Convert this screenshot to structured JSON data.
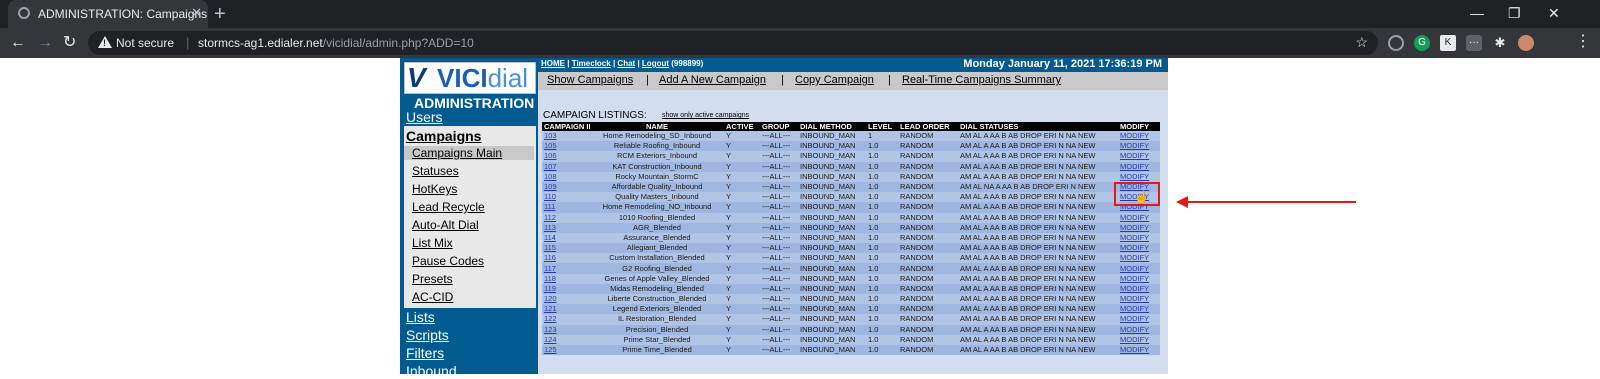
{
  "browser": {
    "tab_title": "ADMINISTRATION: Campaigns",
    "tab_close": "✕",
    "new_tab": "+",
    "minimize": "—",
    "restore": "❐",
    "close": "✕",
    "back": "←",
    "forward": "→",
    "reload": "↻",
    "not_secure": "Not secure",
    "url_host": "stormcs-ag1.edialer.net",
    "url_path": "/vicidial/admin.php?ADD=10",
    "star": "☆",
    "menu": "⋮"
  },
  "sidebar": {
    "logo_v": "V",
    "logo_vici": "VICI",
    "logo_dial": "dial",
    "admin_title": "ADMINISTRATION",
    "users": "Users",
    "campaigns": "Campaigns",
    "sub_items": [
      "Campaigns Main",
      "Statuses",
      "HotKeys",
      "Lead Recycle",
      "Auto-Alt Dial",
      "List Mix",
      "Pause Codes",
      "Presets",
      "AC-CID"
    ],
    "lists": "Lists",
    "scripts": "Scripts",
    "filters": "Filters",
    "inbound": "Inbound"
  },
  "topbar": {
    "home": "HOME",
    "timeclock": "Timeclock",
    "chat": "Chat",
    "logout": "Logout",
    "user": "(998899)",
    "sep": "|",
    "date": "Monday January 11, 2021 17:36:19 PM"
  },
  "subnav": {
    "items": [
      "Show Campaigns",
      "Add A New Campaign",
      "Copy Campaign",
      "Real-Time Campaigns Summary"
    ],
    "sep": "|"
  },
  "listing": {
    "title": "CAMPAIGN LISTINGS:",
    "active_link": "show only active campaigns"
  },
  "table": {
    "headers": [
      "CAMPAIGN ID",
      "NAME",
      "ACTIVE",
      "GROUP",
      "DIAL METHOD",
      "LEVEL",
      "LEAD ORDER",
      "DIAL STATUSES",
      "MODIFY"
    ],
    "rows": [
      [
        "103",
        "Home Remodeling_SD_Inbound",
        "Y",
        "---ALL---",
        "INBOUND_MAN",
        "1",
        "RANDOM",
        "AM AL A AA B AB DROP ERI N NA NEW",
        "MODIFY"
      ],
      [
        "105",
        "Reliable Roofing_Inbound",
        "Y",
        "---ALL---",
        "INBOUND_MAN",
        "1.0",
        "RANDOM",
        "AM AL A AA B AB DROP ERI N NA NEW",
        "MODIFY"
      ],
      [
        "106",
        "RCM Exteriors_Inbound",
        "Y",
        "---ALL---",
        "INBOUND_MAN",
        "1.0",
        "RANDOM",
        "AM AL A AA B AB DROP ERI N NA NEW",
        "MODIFY"
      ],
      [
        "107",
        "KAT Construction_Inbound",
        "Y",
        "---ALL---",
        "INBOUND_MAN",
        "1.0",
        "RANDOM",
        "AM AL A AA B AB DROP ERI N NA NEW",
        "MODIFY"
      ],
      [
        "108",
        "Rocky Mountain_StormC",
        "Y",
        "---ALL---",
        "INBOUND_MAN",
        "1.0",
        "RANDOM",
        "AM AL A AA B AB DROP ERI N NA NEW",
        "MODIFY"
      ],
      [
        "109",
        "Affordable Quality_Inbound",
        "Y",
        "---ALL---",
        "INBOUND_MAN",
        "1.0",
        "RANDOM",
        "AM AL NA A AA B AB DROP ERI N NEW",
        "MODIFY"
      ],
      [
        "110",
        "Quality Masters_Inbound",
        "Y",
        "---ALL---",
        "INBOUND_MAN",
        "1.0",
        "RANDOM",
        "AM AL A AA B AB DROP ERI N NA NEW",
        "MODIFY"
      ],
      [
        "111",
        "Home Remodeling_NO_Inbound",
        "Y",
        "---ALL---",
        "INBOUND_MAN",
        "1.0",
        "RANDOM",
        "AM AL A AA B AB DROP ERI N NA NEW",
        "MODIFY"
      ],
      [
        "112",
        "1010 Roofing_Blended",
        "Y",
        "---ALL---",
        "INBOUND_MAN",
        "1.0",
        "RANDOM",
        "AM AL A AA B AB DROP ERI N NA NEW",
        "MODIFY"
      ],
      [
        "113",
        "AGR_Blended",
        "Y",
        "---ALL---",
        "INBOUND_MAN",
        "1.0",
        "RANDOM",
        "AM AL A AA B AB DROP ERI N NA NEW",
        "MODIFY"
      ],
      [
        "114",
        "Assurance_Blended",
        "Y",
        "---ALL---",
        "INBOUND_MAN",
        "1.0",
        "RANDOM",
        "AM AL A AA B AB DROP ERI N NA NEW",
        "MODIFY"
      ],
      [
        "115",
        "Allegiant_Blended",
        "Y",
        "---ALL---",
        "INBOUND_MAN",
        "1.0",
        "RANDOM",
        "AM AL A AA B AB DROP ERI N NA NEW",
        "MODIFY"
      ],
      [
        "116",
        "Custom Installation_Blended",
        "Y",
        "---ALL---",
        "INBOUND_MAN",
        "1.0",
        "RANDOM",
        "AM AL A AA B AB DROP ERI N NA NEW",
        "MODIFY"
      ],
      [
        "117",
        "G2 Roofing_Blended",
        "Y",
        "---ALL---",
        "INBOUND_MAN",
        "1.0",
        "RANDOM",
        "AM AL A AA B AB DROP ERI N NA NEW",
        "MODIFY"
      ],
      [
        "118",
        "Genes of Apple Valley_Blended",
        "Y",
        "---ALL---",
        "INBOUND_MAN",
        "1.0",
        "RANDOM",
        "AM AL A AA B AB DROP ERI N NA NEW",
        "MODIFY"
      ],
      [
        "119",
        "Midas Remodeling_Blended",
        "Y",
        "---ALL---",
        "INBOUND_MAN",
        "1.0",
        "RANDOM",
        "AM AL A AA B AB DROP ERI N NA NEW",
        "MODIFY"
      ],
      [
        "120",
        "Liberte Construction_Blended",
        "Y",
        "---ALL---",
        "INBOUND_MAN",
        "1.0",
        "RANDOM",
        "AM AL A AA B AB DROP ERI N NA NEW",
        "MODIFY"
      ],
      [
        "121",
        "Legend Exteriors_Blended",
        "Y",
        "---ALL---",
        "INBOUND_MAN",
        "1.0",
        "RANDOM",
        "AM AL A AA B AB DROP ERI N NA NEW",
        "MODIFY"
      ],
      [
        "122",
        "IL Restoration_Blended",
        "Y",
        "---ALL---",
        "INBOUND_MAN",
        "1.0",
        "RANDOM",
        "AM AL A AA B AB DROP ERI N NA NEW",
        "MODIFY"
      ],
      [
        "123",
        "Precision_Blended",
        "Y",
        "---ALL---",
        "INBOUND_MAN",
        "1.0",
        "RANDOM",
        "AM AL A AA B AB DROP ERI N NA NEW",
        "MODIFY"
      ],
      [
        "124",
        "Prime Star_Blended",
        "Y",
        "---ALL---",
        "INBOUND_MAN",
        "1.0",
        "RANDOM",
        "AM AL A AA B AB DROP ERI N NA NEW",
        "MODIFY"
      ],
      [
        "125",
        "Prime Time_Blended",
        "Y",
        "---ALL---",
        "INBOUND_MAN",
        "1.0",
        "RANDOM",
        "AM AL A AA B AB DROP ERI N NA NEW",
        "MODIFY"
      ]
    ]
  }
}
